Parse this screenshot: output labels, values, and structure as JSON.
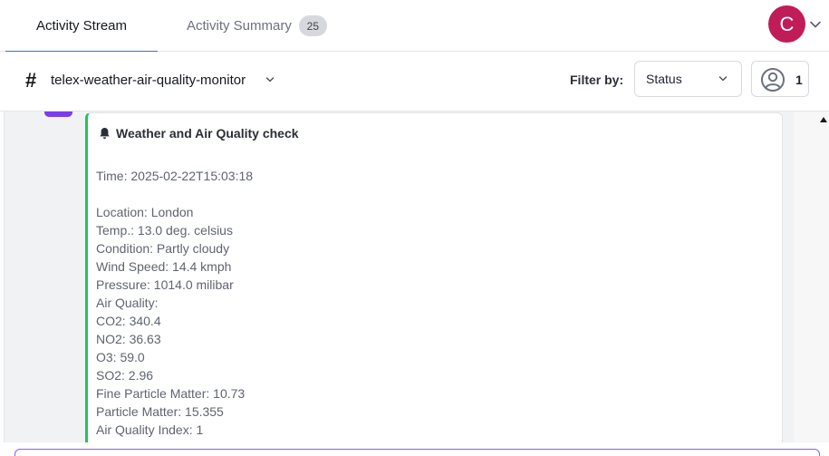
{
  "tabs": {
    "stream_label": "Activity Stream",
    "summary_label": "Activity Summary",
    "summary_count": "25"
  },
  "user": {
    "avatar_initial": "C",
    "avatar_color": "#c01c57"
  },
  "channel": {
    "hash_symbol": "#",
    "name": "telex-weather-air-quality-monitor"
  },
  "filter": {
    "label": "Filter by:",
    "selected": "Status"
  },
  "members": {
    "count": "1"
  },
  "message": {
    "title": "Weather and Air Quality check",
    "body": "Time: 2025-02-22T15:03:18\n\nLocation: London\nTemp.: 13.0 deg. celsius\nCondition: Partly cloudy\nWind Speed: 14.4 kmph\nPressure: 1014.0 milibar\nAir Quality:\nCO2: 340.4\nNO2: 36.63\nO3: 59.0\nSO2: 2.96\nFine Particle Matter: 10.73\nParticle Matter: 15.355\nAir Quality Index: 1",
    "accent_color": "#24c25a"
  },
  "colors": {
    "tab_active_underline": "#3b6fd6",
    "composer_border": "#8b5cf6",
    "event_marker": "#7a3cf0"
  }
}
